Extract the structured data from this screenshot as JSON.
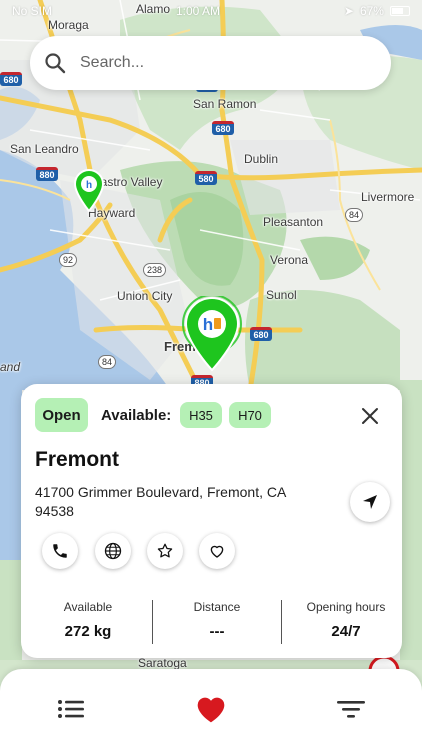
{
  "status_bar": {
    "carrier": "No SIM",
    "time": "1:00 AM",
    "battery": "67%"
  },
  "search": {
    "placeholder": "Search..."
  },
  "map": {
    "places": [
      "Alamo",
      "Moraga",
      "San Ramon",
      "San Leandro",
      "Castro Valley",
      "Hayward",
      "Dublin",
      "Livermore",
      "Pleasanton",
      "Verona",
      "Union City",
      "Sunol",
      "Fremont",
      "Saratoga",
      "and"
    ],
    "highways": [
      "680",
      "580",
      "880",
      "84",
      "92",
      "238"
    ]
  },
  "station_card": {
    "status": "Open",
    "available_label": "Available:",
    "fuel_types": [
      "H35",
      "H70"
    ],
    "name": "Fremont",
    "address": "41700 Grimmer Boulevard, Fremont, CA 94538",
    "stats": [
      {
        "label": "Available",
        "value": "272 kg"
      },
      {
        "label": "Distance",
        "value": "---"
      },
      {
        "label": "Opening hours",
        "value": "24/7"
      }
    ]
  },
  "colors": {
    "accent_green": "#1ec51e",
    "pill_green": "#b5f0b5",
    "favorite_red": "#d7191f"
  }
}
